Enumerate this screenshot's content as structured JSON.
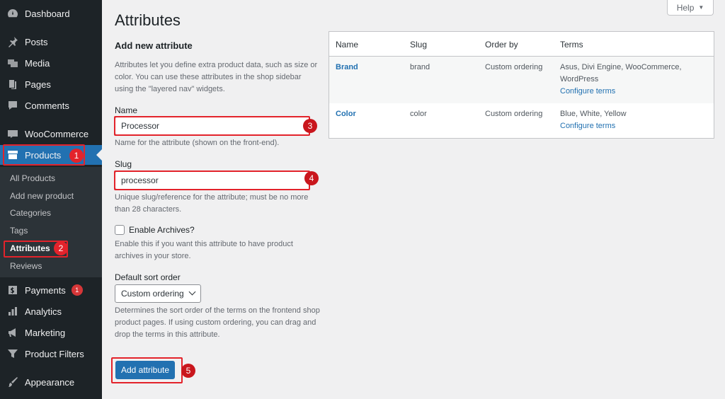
{
  "sidebar": {
    "items": [
      {
        "label": "Dashboard",
        "icon": "dashboard-icon"
      },
      {
        "label": "Posts",
        "icon": "pin-icon"
      },
      {
        "label": "Media",
        "icon": "media-icon"
      },
      {
        "label": "Pages",
        "icon": "pages-icon"
      },
      {
        "label": "Comments",
        "icon": "comments-icon"
      },
      {
        "label": "WooCommerce",
        "icon": "woocommerce-icon"
      },
      {
        "label": "Products",
        "icon": "archive-icon"
      },
      {
        "label": "Payments",
        "icon": "dollar-icon",
        "badge": "1"
      },
      {
        "label": "Analytics",
        "icon": "bar-chart-icon"
      },
      {
        "label": "Marketing",
        "icon": "megaphone-icon"
      },
      {
        "label": "Product Filters",
        "icon": "filter-icon"
      },
      {
        "label": "Appearance",
        "icon": "brush-icon"
      }
    ],
    "submenu": [
      "All Products",
      "Add new product",
      "Categories",
      "Tags",
      "Attributes",
      "Reviews"
    ]
  },
  "header": {
    "title": "Attributes",
    "help_label": "Help"
  },
  "form": {
    "heading": "Add new attribute",
    "intro": "Attributes let you define extra product data, such as size or color. You can use these attributes in the shop sidebar using the \"layered nav\" widgets.",
    "name_label": "Name",
    "name_value": "Processor",
    "name_desc": "Name for the attribute (shown on the front-end).",
    "slug_label": "Slug",
    "slug_value": "processor",
    "slug_desc": "Unique slug/reference for the attribute; must be no more than 28 characters.",
    "archives_label": "Enable Archives?",
    "archives_desc": "Enable this if you want this attribute to have product archives in your store.",
    "sort_label": "Default sort order",
    "sort_value": "Custom ordering",
    "sort_desc": "Determines the sort order of the terms on the frontend shop product pages. If using custom ordering, you can drag and drop the terms in this attribute.",
    "submit_label": "Add attribute"
  },
  "table": {
    "headers": [
      "Name",
      "Slug",
      "Order by",
      "Terms"
    ],
    "rows": [
      {
        "name": "Brand",
        "slug": "brand",
        "order": "Custom ordering",
        "terms": "Asus, Divi Engine, WooCommerce, WordPress",
        "link": "Configure terms"
      },
      {
        "name": "Color",
        "slug": "color",
        "order": "Custom ordering",
        "terms": "Blue, White, Yellow",
        "link": "Configure terms"
      }
    ]
  },
  "annotations": [
    "1",
    "2",
    "3",
    "4",
    "5"
  ],
  "colors": {
    "sidebar_bg": "#1d2327",
    "accent": "#2271b1",
    "highlight": "#e3232b",
    "badge": "#d63638"
  }
}
